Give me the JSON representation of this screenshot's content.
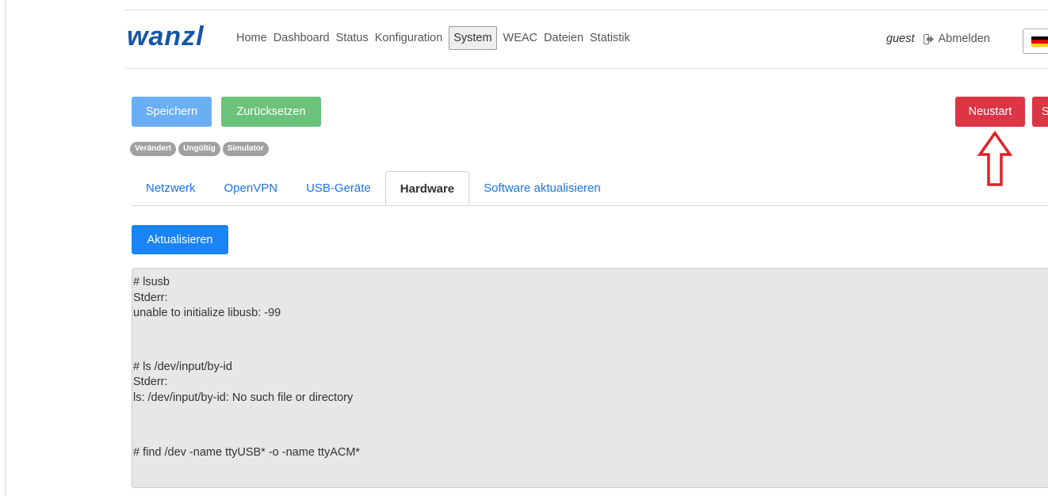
{
  "header": {
    "logo": "wanzl",
    "nav_items": [
      "Home",
      "Dashboard",
      "Status",
      "Konfiguration",
      "System",
      "WEAC",
      "Dateien",
      "Statistik"
    ],
    "active_nav": "System",
    "user": "guest",
    "logout_label": "Abmelden",
    "language_flag": "de"
  },
  "toolbar": {
    "save_label": "Speichern",
    "reset_label": "Zurücksetzen",
    "restart_label": "Neustart",
    "s_label": "S"
  },
  "badges": [
    "Verändert",
    "Ungültig",
    "Simulator"
  ],
  "tabs": {
    "items": [
      "Netzwerk",
      "OpenVPN",
      "USB-Geräte",
      "Hardware",
      "Software aktualisieren"
    ],
    "active": "Hardware"
  },
  "refresh_label": "Aktualisieren",
  "console": {
    "block1": [
      "# lsusb",
      "Stderr:",
      "unable to initialize libusb: -99"
    ],
    "block2": [
      "# ls /dev/input/by-id",
      "Stderr:",
      "ls: /dev/input/by-id: No such file or directory"
    ],
    "block3": [
      "# find /dev -name ttyUSB* -o -name ttyACM*"
    ]
  },
  "colors": {
    "brand": "#1756a6",
    "primary": "#1a83f5",
    "save": "#6aaef3",
    "reset": "#6cc27a",
    "danger": "#dc3545",
    "annotation_arrow": "#e41e26"
  }
}
